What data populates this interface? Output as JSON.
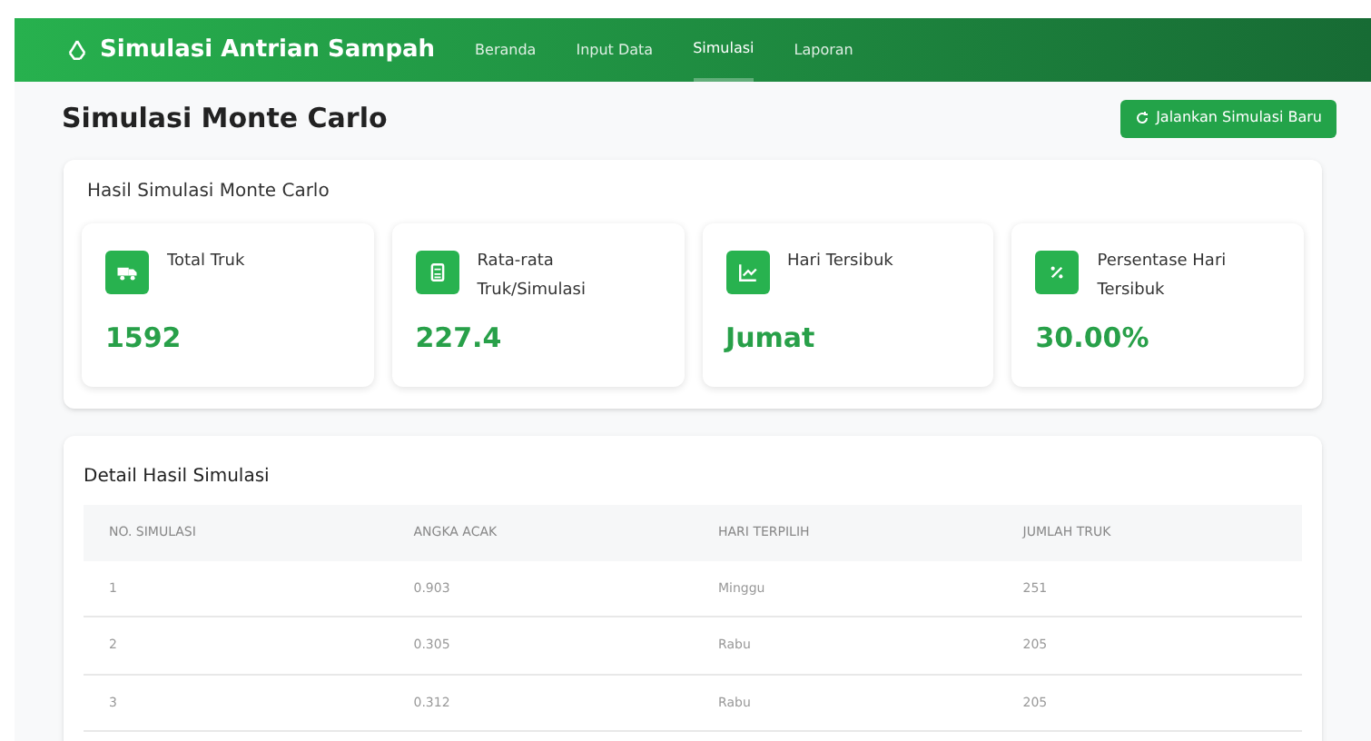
{
  "navbar": {
    "brand": "Simulasi Antrian Sampah",
    "links": [
      {
        "label": "Beranda",
        "selected": false
      },
      {
        "label": "Input Data",
        "selected": false
      },
      {
        "label": "Simulasi",
        "selected": true
      },
      {
        "label": "Laporan",
        "selected": false
      }
    ]
  },
  "header": {
    "title": "Simulasi Monte Carlo",
    "button": "Jalankan Simulasi Baru"
  },
  "summary": {
    "title": "Hasil Simulasi Monte Carlo",
    "cards": [
      {
        "kind": "truck",
        "label": "Total Truk",
        "value": "1592"
      },
      {
        "kind": "calculator",
        "label": "Rata-rata Truk/Simulasi",
        "value": "227.4"
      },
      {
        "kind": "chart",
        "label": "Hari Tersibuk",
        "value": "Jumat"
      },
      {
        "kind": "percent",
        "label": "Persentase Hari Tersibuk",
        "value": "30.00%"
      }
    ]
  },
  "detail": {
    "title": "Detail Hasil Simulasi",
    "columns": [
      "NO. SIMULASI",
      "ANGKA ACAK",
      "HARI TERPILIH",
      "JUMLAH TRUK"
    ],
    "rows": [
      [
        "1",
        "0.903",
        "Minggu",
        "251"
      ],
      [
        "2",
        "0.305",
        "Rabu",
        "205"
      ],
      [
        "3",
        "0.312",
        "Rabu",
        "205"
      ]
    ]
  }
}
